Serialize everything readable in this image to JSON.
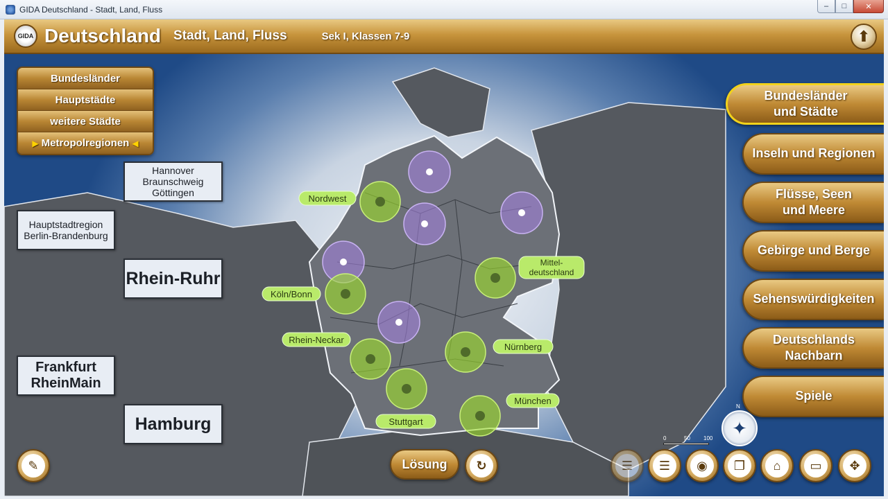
{
  "window": {
    "title": "GIDA Deutschland - Stadt, Land, Fluss",
    "minimize_glyph": "–",
    "maximize_glyph": "□",
    "close_glyph": "✕"
  },
  "header": {
    "logo_text": "GIDA",
    "title": "Deutschland",
    "subtitle": "Stadt, Land, Fluss",
    "level": "Sek I, Klassen 7-9",
    "up_glyph": "⬆"
  },
  "category_menu": [
    {
      "label": "Bundesländer",
      "selected": false
    },
    {
      "label": "Hauptstädte",
      "selected": false
    },
    {
      "label": "weitere Städte",
      "selected": false
    },
    {
      "label": "Metropolregionen",
      "selected": true
    }
  ],
  "selected_marker_left": "▶",
  "selected_marker_right": "◀",
  "answer_boxes": [
    {
      "lines": [
        "Hannover",
        "Braunschweig",
        "Göttingen"
      ]
    },
    {
      "lines": [
        "Hauptstadtregion",
        "Berlin-Brandenburg"
      ]
    },
    {
      "lines": [
        "Rhein-Ruhr"
      ]
    },
    {
      "lines": [
        "Frankfurt",
        "RheinMain"
      ]
    },
    {
      "lines": [
        "Hamburg"
      ]
    }
  ],
  "map_labels": {
    "nordwest": "Nordwest",
    "mittel_1": "Mittel-",
    "mittel_2": "deutschland",
    "koeln": "Köln/Bonn",
    "rhein_neckar": "Rhein-Neckar",
    "nuernberg": "Nürnberg",
    "muenchen": "München",
    "stuttgart": "Stuttgart"
  },
  "right_nav": [
    {
      "label_1": "Bundesländer",
      "label_2": "und Städte",
      "active": true
    },
    {
      "label_1": "Inseln und Regionen",
      "label_2": "",
      "active": false
    },
    {
      "label_1": "Flüsse, Seen",
      "label_2": "und Meere",
      "active": false
    },
    {
      "label_1": "Gebirge und Berge",
      "label_2": "",
      "active": false
    },
    {
      "label_1": "Sehenswürdigkeiten",
      "label_2": "",
      "active": false
    },
    {
      "label_1": "Deutschlands",
      "label_2": "Nachbarn",
      "active": false
    },
    {
      "label_1": "Spiele",
      "label_2": "",
      "active": false
    }
  ],
  "toolbar": {
    "loesung_label": "Lösung",
    "notes_glyph": "✎",
    "reset_glyph": "↻",
    "list_glyph": "☰",
    "camera_glyph": "◉",
    "copy_glyph": "❐",
    "home_glyph": "⌂",
    "window_glyph": "▭",
    "nav_glyph": "✥"
  },
  "scale": {
    "t0": "0",
    "t1": "50",
    "t2": "100"
  },
  "compass": {
    "n": "N",
    "glyph": "✦"
  },
  "colors": {
    "gold": "#c08a35",
    "green_marker": "#9fe02a",
    "purple_marker": "#a784e6",
    "active_border": "#f2d21a"
  }
}
